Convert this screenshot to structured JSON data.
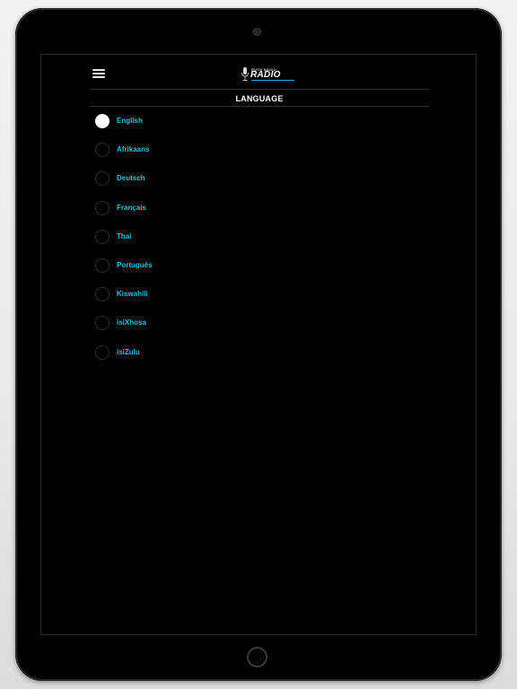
{
  "app": {
    "logo_text_main": "RADIO",
    "logo_text_top": "RUTH NAIDU",
    "accent_color": "#2bc0e4"
  },
  "header": {
    "menu_icon": "hamburger-icon",
    "title": "LANGUAGE"
  },
  "languages": {
    "selected_index": 0,
    "items": [
      {
        "label": "English",
        "selected": true
      },
      {
        "label": "Afrikaans",
        "selected": false
      },
      {
        "label": "Deutsch",
        "selected": false
      },
      {
        "label": "Français",
        "selected": false
      },
      {
        "label": "Thai",
        "selected": false
      },
      {
        "label": "Português",
        "selected": false
      },
      {
        "label": "Kiswahili",
        "selected": false
      },
      {
        "label": "isiXhosa",
        "selected": false
      },
      {
        "label": "isiZulu",
        "selected": false
      }
    ]
  }
}
